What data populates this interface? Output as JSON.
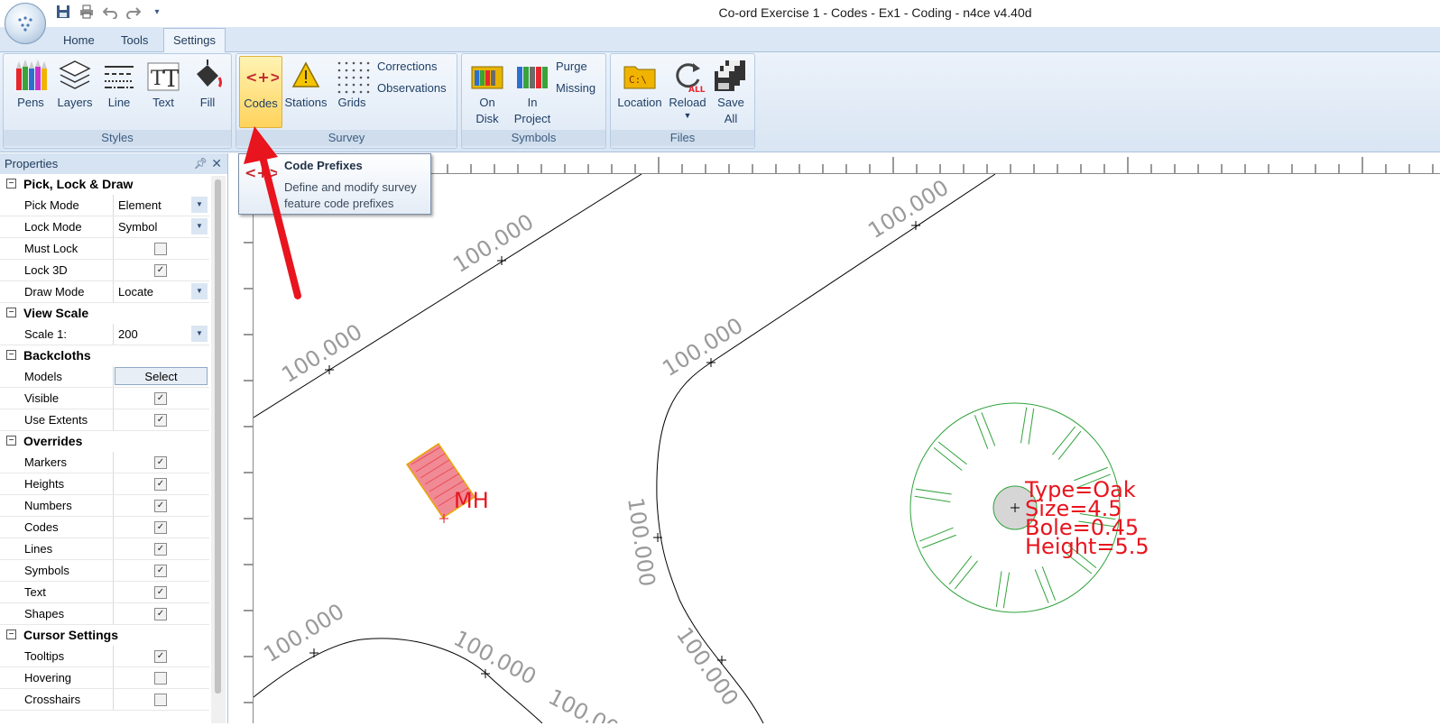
{
  "window": {
    "title": "Co-ord Exercise 1 - Codes - Ex1 - Coding - n4ce v4.40d"
  },
  "quick_access": [
    "save-icon",
    "print-icon",
    "undo-icon",
    "redo-icon",
    "customize-icon"
  ],
  "tabs": [
    {
      "label": "Home"
    },
    {
      "label": "Tools"
    },
    {
      "label": "Settings",
      "active": true
    }
  ],
  "ribbon": {
    "styles": {
      "label": "Styles",
      "buttons": [
        "Pens",
        "Layers",
        "Line",
        "Text",
        "Fill"
      ]
    },
    "survey": {
      "label": "Survey",
      "buttons": [
        "Codes",
        "Stations",
        "Grids"
      ],
      "small": [
        "Corrections",
        "Observations"
      ]
    },
    "symbols": {
      "label": "Symbols",
      "on_disk_1": "On",
      "on_disk_2": "Disk",
      "in_project_1": "In",
      "in_project_2": "Project",
      "small": [
        "Purge",
        "Missing"
      ]
    },
    "files": {
      "label": "Files",
      "location": "Location",
      "reload": "Reload",
      "save_all_1": "Save",
      "save_all_2": "All",
      "reload_badge": "ALL"
    }
  },
  "tooltip": {
    "title": "Code Prefixes",
    "desc_1": "Define and modify survey",
    "desc_2": "feature code prefixes"
  },
  "properties": {
    "title": "Properties",
    "pick_lock_draw": {
      "label": "Pick, Lock & Draw",
      "pick_mode": {
        "label": "Pick Mode",
        "value": "Element"
      },
      "lock_mode": {
        "label": "Lock Mode",
        "value": "Symbol"
      },
      "must_lock": {
        "label": "Must Lock",
        "checked": false
      },
      "lock_3d": {
        "label": "Lock 3D",
        "checked": true
      },
      "draw_mode": {
        "label": "Draw Mode",
        "value": "Locate"
      }
    },
    "view_scale": {
      "label": "View Scale",
      "scale": {
        "label": "Scale 1:",
        "value": "200"
      }
    },
    "backcloths": {
      "label": "Backcloths",
      "models": {
        "label": "Models",
        "button": "Select"
      },
      "visible": {
        "label": "Visible",
        "checked": true
      },
      "use_extents": {
        "label": "Use Extents",
        "checked": true
      }
    },
    "overrides": {
      "label": "Overrides",
      "markers": {
        "label": "Markers",
        "checked": true
      },
      "heights": {
        "label": "Heights",
        "checked": true
      },
      "numbers": {
        "label": "Numbers",
        "checked": true
      },
      "codes": {
        "label": "Codes",
        "checked": true
      },
      "lines": {
        "label": "Lines",
        "checked": true
      },
      "symbols": {
        "label": "Symbols",
        "checked": true
      },
      "text": {
        "label": "Text",
        "checked": true
      },
      "shapes": {
        "label": "Shapes",
        "checked": true
      }
    },
    "cursor_settings": {
      "label": "Cursor Settings",
      "tooltips": {
        "label": "Tooltips",
        "checked": true
      },
      "hovering": {
        "label": "Hovering",
        "checked": false
      },
      "crosshairs": {
        "label": "Crosshairs",
        "checked": false
      }
    }
  },
  "drawing": {
    "contour_label": "100.000",
    "manhole_label": "MH",
    "tree": {
      "type": "Type=Oak",
      "size": "Size=4.5",
      "bole": "Bole=0.45",
      "height": "Height=5.5"
    },
    "colors": {
      "tree": "#2fa33a",
      "annotation": "#e8141e",
      "contour_label": "#9a9a9a"
    }
  }
}
